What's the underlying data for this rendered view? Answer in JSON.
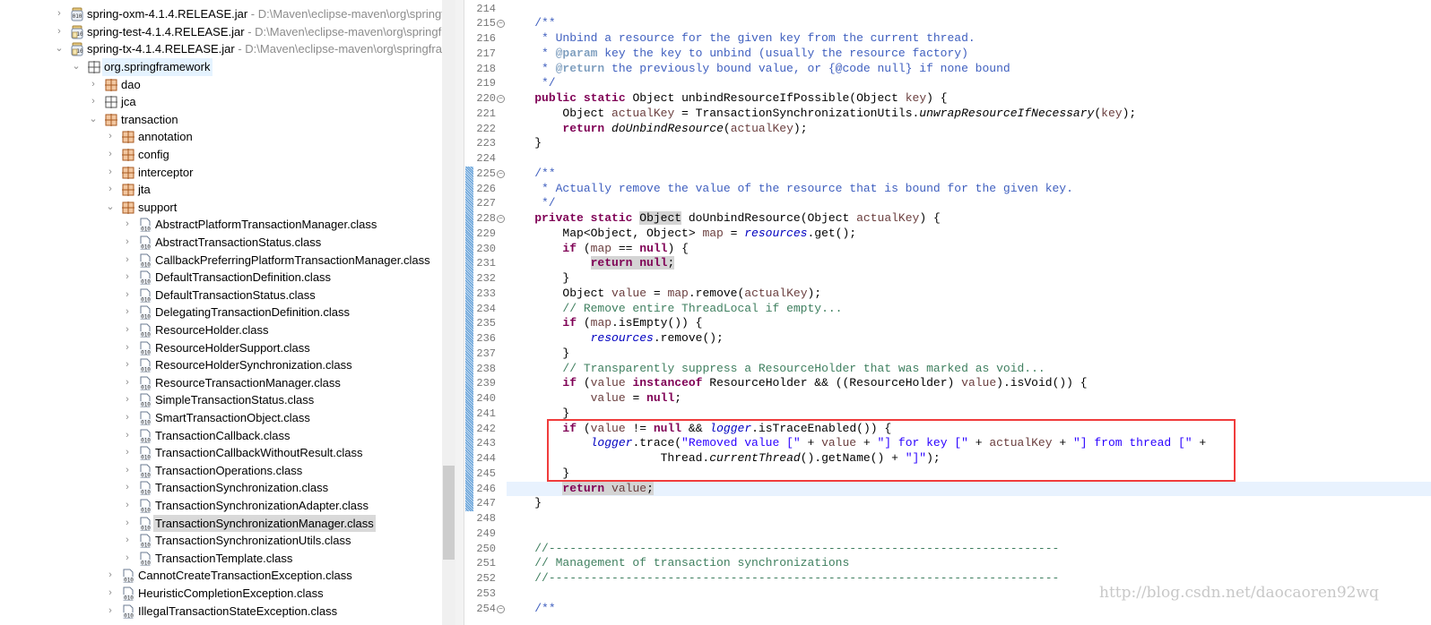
{
  "tree": {
    "rows": [
      {
        "depth": 0,
        "open": false,
        "icon": "jar-binary",
        "label": "spring-oxm-4.1.4.RELEASE.jar",
        "path": " - D:\\Maven\\eclipse-maven\\org\\springfr"
      },
      {
        "depth": 0,
        "open": false,
        "icon": "jar-source",
        "label": "spring-test-4.1.4.RELEASE.jar",
        "path": " - D:\\Maven\\eclipse-maven\\org\\springfra"
      },
      {
        "depth": 0,
        "open": true,
        "icon": "jar-source",
        "label": "spring-tx-4.1.4.RELEASE.jar",
        "path": " - D:\\Maven\\eclipse-maven\\org\\springfram"
      },
      {
        "depth": 1,
        "open": true,
        "icon": "package-empty",
        "label": "org.springframework",
        "focus": true
      },
      {
        "depth": 2,
        "open": false,
        "icon": "package",
        "label": "dao"
      },
      {
        "depth": 2,
        "open": false,
        "icon": "package-empty",
        "label": "jca"
      },
      {
        "depth": 2,
        "open": true,
        "icon": "package",
        "label": "transaction"
      },
      {
        "depth": 3,
        "open": false,
        "icon": "package",
        "label": "annotation"
      },
      {
        "depth": 3,
        "open": false,
        "icon": "package",
        "label": "config"
      },
      {
        "depth": 3,
        "open": false,
        "icon": "package",
        "label": "interceptor"
      },
      {
        "depth": 3,
        "open": false,
        "icon": "package",
        "label": "jta"
      },
      {
        "depth": 3,
        "open": true,
        "icon": "package",
        "label": "support"
      },
      {
        "depth": 4,
        "open": false,
        "icon": "class",
        "label": "AbstractPlatformTransactionManager.class"
      },
      {
        "depth": 4,
        "open": false,
        "icon": "class",
        "label": "AbstractTransactionStatus.class"
      },
      {
        "depth": 4,
        "open": false,
        "icon": "class",
        "label": "CallbackPreferringPlatformTransactionManager.class"
      },
      {
        "depth": 4,
        "open": false,
        "icon": "class",
        "label": "DefaultTransactionDefinition.class"
      },
      {
        "depth": 4,
        "open": false,
        "icon": "class",
        "label": "DefaultTransactionStatus.class"
      },
      {
        "depth": 4,
        "open": false,
        "icon": "class",
        "label": "DelegatingTransactionDefinition.class"
      },
      {
        "depth": 4,
        "open": false,
        "icon": "class",
        "label": "ResourceHolder.class"
      },
      {
        "depth": 4,
        "open": false,
        "icon": "class",
        "label": "ResourceHolderSupport.class"
      },
      {
        "depth": 4,
        "open": false,
        "icon": "class",
        "label": "ResourceHolderSynchronization.class"
      },
      {
        "depth": 4,
        "open": false,
        "icon": "class",
        "label": "ResourceTransactionManager.class"
      },
      {
        "depth": 4,
        "open": false,
        "icon": "class",
        "label": "SimpleTransactionStatus.class"
      },
      {
        "depth": 4,
        "open": false,
        "icon": "class",
        "label": "SmartTransactionObject.class"
      },
      {
        "depth": 4,
        "open": false,
        "icon": "class",
        "label": "TransactionCallback.class"
      },
      {
        "depth": 4,
        "open": false,
        "icon": "class",
        "label": "TransactionCallbackWithoutResult.class"
      },
      {
        "depth": 4,
        "open": false,
        "icon": "class",
        "label": "TransactionOperations.class"
      },
      {
        "depth": 4,
        "open": false,
        "icon": "class",
        "label": "TransactionSynchronization.class"
      },
      {
        "depth": 4,
        "open": false,
        "icon": "class",
        "label": "TransactionSynchronizationAdapter.class"
      },
      {
        "depth": 4,
        "open": false,
        "icon": "class",
        "label": "TransactionSynchronizationManager.class",
        "selected": true
      },
      {
        "depth": 4,
        "open": false,
        "icon": "class",
        "label": "TransactionSynchronizationUtils.class"
      },
      {
        "depth": 4,
        "open": false,
        "icon": "class",
        "label": "TransactionTemplate.class"
      },
      {
        "depth": 3,
        "open": false,
        "icon": "class",
        "label": "CannotCreateTransactionException.class"
      },
      {
        "depth": 3,
        "open": false,
        "icon": "class",
        "label": "HeuristicCompletionException.class"
      },
      {
        "depth": 3,
        "open": false,
        "icon": "class",
        "label": "IllegalTransactionStateException.class"
      }
    ]
  },
  "editor": {
    "first_line": 214,
    "current_line": 246,
    "changed_lines": [
      225,
      247
    ],
    "folds": [
      215,
      220,
      225,
      228,
      254
    ],
    "lines": [
      [],
      [
        [
          "",
          "    "
        ],
        [
          "jd",
          "/**"
        ]
      ],
      [
        [
          "jd",
          "     * Unbind a resource for the given key from the current thread."
        ]
      ],
      [
        [
          "jd",
          "     * "
        ],
        [
          "jt",
          "@param"
        ],
        [
          "jd",
          " key the key to unbind (usually the resource factory)"
        ]
      ],
      [
        [
          "jd",
          "     * "
        ],
        [
          "jt",
          "@return"
        ],
        [
          "jd",
          " the previously bound value, or {@code null} if none bound"
        ]
      ],
      [
        [
          "jd",
          "     */"
        ]
      ],
      [
        [
          "",
          "    "
        ],
        [
          "kw",
          "public"
        ],
        [
          "",
          " "
        ],
        [
          "kw",
          "static"
        ],
        [
          "",
          " Object unbindResourceIfPossible(Object "
        ],
        [
          "vr",
          "key"
        ],
        [
          "",
          ") {"
        ]
      ],
      [
        [
          "",
          "        Object "
        ],
        [
          "vr",
          "actualKey"
        ],
        [
          "",
          " = TransactionSynchronizationUtils."
        ],
        [
          "it",
          "unwrapResourceIfNecessary"
        ],
        [
          "",
          "("
        ],
        [
          "vr",
          "key"
        ],
        [
          "",
          ");"
        ]
      ],
      [
        [
          "",
          "        "
        ],
        [
          "kw",
          "return"
        ],
        [
          "",
          " "
        ],
        [
          "it",
          "doUnbindResource"
        ],
        [
          "",
          "("
        ],
        [
          "vr",
          "actualKey"
        ],
        [
          "",
          ");"
        ]
      ],
      [
        [
          "",
          "    }"
        ]
      ],
      [],
      [
        [
          "",
          "    "
        ],
        [
          "jd",
          "/**"
        ]
      ],
      [
        [
          "jd",
          "     * Actually remove the value of the resource that is bound for the given key."
        ]
      ],
      [
        [
          "jd",
          "     */"
        ]
      ],
      [
        [
          "",
          "    "
        ],
        [
          "kw",
          "private"
        ],
        [
          "",
          " "
        ],
        [
          "kw",
          "static"
        ],
        [
          "",
          " "
        ],
        [
          "hl",
          "Object"
        ],
        [
          "",
          " doUnbindResource(Object "
        ],
        [
          "vr",
          "actualKey"
        ],
        [
          "",
          ") {"
        ]
      ],
      [
        [
          "",
          "        Map<Object, Object> "
        ],
        [
          "vr",
          "map"
        ],
        [
          "",
          " = "
        ],
        [
          "fd",
          "resources"
        ],
        [
          "",
          ".get();"
        ]
      ],
      [
        [
          "",
          "        "
        ],
        [
          "kw",
          "if"
        ],
        [
          "",
          " ("
        ],
        [
          "vr",
          "map"
        ],
        [
          "",
          " == "
        ],
        [
          "kw",
          "null"
        ],
        [
          "",
          ") {"
        ]
      ],
      [
        [
          "",
          "            "
        ],
        [
          "kw hl",
          "return"
        ],
        [
          "hl",
          " "
        ],
        [
          "kw hl",
          "null"
        ],
        [
          "hl",
          ";"
        ]
      ],
      [
        [
          "",
          "        }"
        ]
      ],
      [
        [
          "",
          "        Object "
        ],
        [
          "vr",
          "value"
        ],
        [
          "",
          " = "
        ],
        [
          "vr",
          "map"
        ],
        [
          "",
          ".remove("
        ],
        [
          "vr",
          "actualKey"
        ],
        [
          "",
          ");"
        ]
      ],
      [
        [
          "",
          "        "
        ],
        [
          "cm",
          "// Remove entire ThreadLocal if empty..."
        ]
      ],
      [
        [
          "",
          "        "
        ],
        [
          "kw",
          "if"
        ],
        [
          "",
          " ("
        ],
        [
          "vr",
          "map"
        ],
        [
          "",
          ".isEmpty()) {"
        ]
      ],
      [
        [
          "",
          "            "
        ],
        [
          "fd",
          "resources"
        ],
        [
          "",
          ".remove();"
        ]
      ],
      [
        [
          "",
          "        }"
        ]
      ],
      [
        [
          "",
          "        "
        ],
        [
          "cm",
          "// Transparently suppress a ResourceHolder that was marked as void..."
        ]
      ],
      [
        [
          "",
          "        "
        ],
        [
          "kw",
          "if"
        ],
        [
          "",
          " ("
        ],
        [
          "vr",
          "value"
        ],
        [
          "",
          " "
        ],
        [
          "kw",
          "instanceof"
        ],
        [
          "",
          " ResourceHolder && ((ResourceHolder) "
        ],
        [
          "vr",
          "value"
        ],
        [
          "",
          ").isVoid()) {"
        ]
      ],
      [
        [
          "",
          "            "
        ],
        [
          "vr",
          "value"
        ],
        [
          "",
          " = "
        ],
        [
          "kw",
          "null"
        ],
        [
          "",
          ";"
        ]
      ],
      [
        [
          "",
          "        }"
        ]
      ],
      [
        [
          "",
          "        "
        ],
        [
          "kw",
          "if"
        ],
        [
          "",
          " ("
        ],
        [
          "vr",
          "value"
        ],
        [
          "",
          " != "
        ],
        [
          "kw",
          "null"
        ],
        [
          "",
          " && "
        ],
        [
          "fd",
          "logger"
        ],
        [
          "",
          ".isTraceEnabled()) {"
        ]
      ],
      [
        [
          "",
          "            "
        ],
        [
          "fd",
          "logger"
        ],
        [
          "",
          ".trace("
        ],
        [
          "st",
          "\"Removed value [\""
        ],
        [
          "",
          " + "
        ],
        [
          "vr",
          "value"
        ],
        [
          "",
          " + "
        ],
        [
          "st",
          "\"] for key [\""
        ],
        [
          "",
          " + "
        ],
        [
          "vr",
          "actualKey"
        ],
        [
          "",
          " + "
        ],
        [
          "st",
          "\"] from thread [\""
        ],
        [
          "",
          " +"
        ]
      ],
      [
        [
          "",
          "                      Thread."
        ],
        [
          "it",
          "currentThread"
        ],
        [
          "",
          "().getName() + "
        ],
        [
          "st",
          "\"]\""
        ],
        [
          "",
          ");"
        ]
      ],
      [
        [
          "",
          "        }"
        ]
      ],
      [
        [
          "",
          "        "
        ],
        [
          "kw hl",
          "return"
        ],
        [
          "hl",
          " "
        ],
        [
          "vr hl",
          "value"
        ],
        [
          "hl",
          ";"
        ]
      ],
      [
        [
          "",
          "    }"
        ]
      ],
      [],
      [],
      [
        [
          "",
          "    "
        ],
        [
          "cm",
          "//-------------------------------------------------------------------------"
        ]
      ],
      [
        [
          "",
          "    "
        ],
        [
          "cm",
          "// Management of transaction synchronizations"
        ]
      ],
      [
        [
          "",
          "    "
        ],
        [
          "cm",
          "//-------------------------------------------------------------------------"
        ]
      ],
      [],
      [
        [
          "",
          "    "
        ],
        [
          "jd",
          "/**"
        ]
      ]
    ]
  },
  "highlight_box_color": "#f03c3c",
  "watermark": "http://blog.csdn.net/daocaoren92wq"
}
